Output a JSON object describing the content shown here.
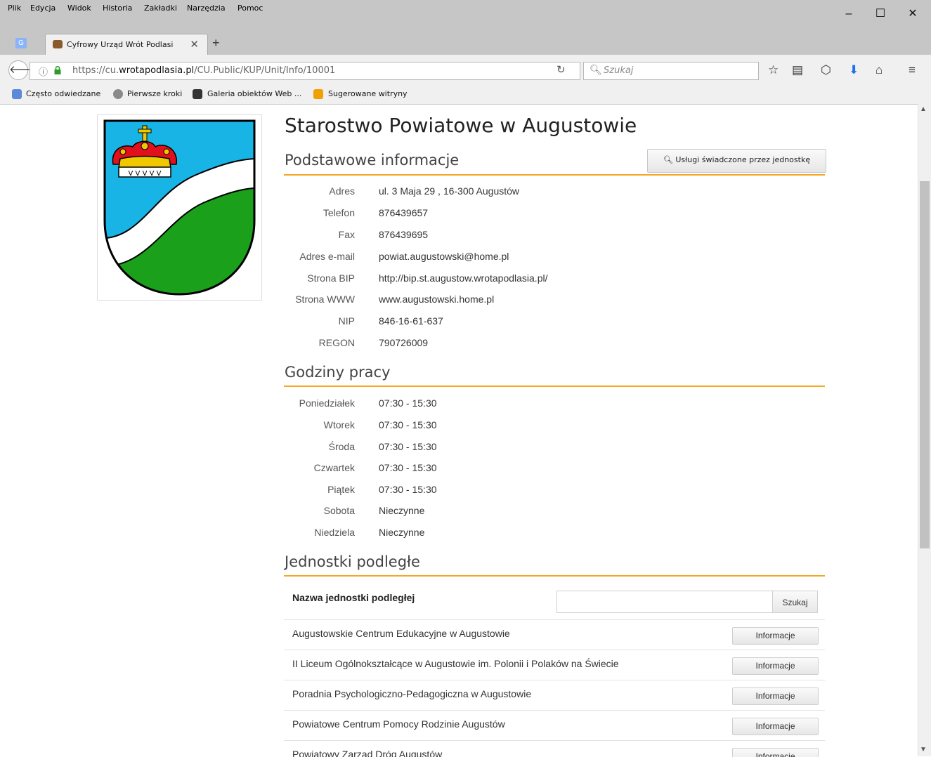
{
  "browser": {
    "menu": [
      "Plik",
      "Edycja",
      "Widok",
      "Historia",
      "Zakładki",
      "Narzędzia",
      "Pomoc"
    ],
    "window_controls": {
      "minimize": "–",
      "maximize": "☐",
      "close": "✕"
    },
    "tab_title": "Cyfrowy Urząd Wrót Podlasi",
    "url": {
      "prefix": "https://cu.",
      "host": "wrotapodlasia.pl",
      "path": "/CU.Public/KUP/Unit/Info/10001"
    },
    "search_placeholder": "Szukaj",
    "bookmarks": [
      "Często odwiedzane",
      "Pierwsze kroki",
      "Galeria obiektów Web ...",
      "Sugerowane witryny"
    ]
  },
  "page": {
    "title": "Starostwo Powiatowe w Augustowie",
    "basic_info": {
      "heading": "Podstawowe informacje",
      "services_button": "Usługi świadczone przez jednostkę",
      "rows": [
        {
          "label": "Adres",
          "value": "ul. 3 Maja 29 , 16-300 Augustów"
        },
        {
          "label": "Telefon",
          "value": "876439657"
        },
        {
          "label": "Fax",
          "value": "876439695"
        },
        {
          "label": "Adres e-mail",
          "value": "powiat.augustowski@home.pl"
        },
        {
          "label": "Strona BIP",
          "value": "http://bip.st.augustow.wrotapodlasia.pl/"
        },
        {
          "label": "Strona WWW",
          "value": "www.augustowski.home.pl"
        },
        {
          "label": "NIP",
          "value": "846-16-61-637"
        },
        {
          "label": "REGON",
          "value": "790726009"
        }
      ]
    },
    "hours": {
      "heading": "Godziny pracy",
      "rows": [
        {
          "label": "Poniedziałek",
          "value": "07:30  -  15:30"
        },
        {
          "label": "Wtorek",
          "value": "07:30  -  15:30"
        },
        {
          "label": "Środa",
          "value": "07:30  -  15:30"
        },
        {
          "label": "Czwartek",
          "value": "07:30  -  15:30"
        },
        {
          "label": "Piątek",
          "value": "07:30  -  15:30"
        },
        {
          "label": "Sobota",
          "value": "Nieczynne"
        },
        {
          "label": "Niedziela",
          "value": "Nieczynne"
        }
      ]
    },
    "subunits": {
      "heading": "Jednostki podległe",
      "column_label": "Nazwa jednostki podległej",
      "search_button": "Szukaj",
      "search_value": "",
      "info_button": "Informacje",
      "items": [
        "Augustowskie Centrum Edukacyjne w Augustowie",
        "II Liceum Ogólnokształcące w Augustowie im. Polonii i Polaków na Świecie",
        "Poradnia Psychologiczno-Pedagogiczna w Augustowie",
        "Powiatowe Centrum Pomocy Rodzinie Augustów",
        "Powiatowy Zarząd Dróg Augustów"
      ]
    }
  },
  "colors": {
    "accent_line": "#f5a623",
    "crest_blue": "#19b4e6",
    "crest_green": "#1aa01a",
    "crown_red": "#e0101c",
    "crown_gold": "#f0c800"
  }
}
